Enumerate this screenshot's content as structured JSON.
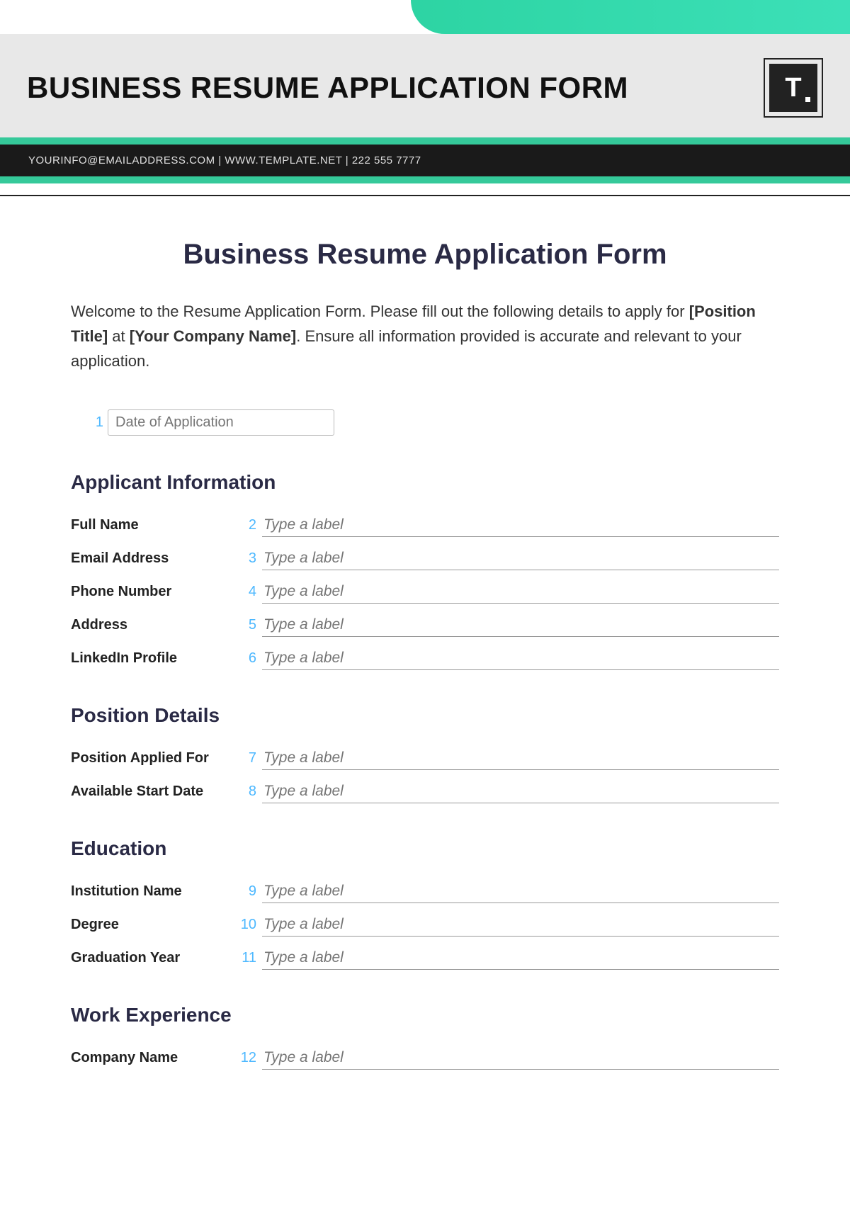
{
  "header": {
    "title": "BUSINESS RESUME APPLICATION FORM",
    "logo_text": "T",
    "contact_line": "YOURINFO@EMAILADDRESS.COM | WWW.TEMPLATE.NET | 222 555 7777"
  },
  "doc_title": "Business Resume Application Form",
  "intro": {
    "pre": "Welcome to the Resume Application Form. Please fill out the following details to apply for ",
    "bold1": "[Position Title]",
    "mid": " at ",
    "bold2": "[Your Company Name]",
    "post": ". Ensure all information provided is accurate and relevant to your application."
  },
  "date_field": {
    "num": "1",
    "placeholder": "Date of Application"
  },
  "sections": [
    {
      "title": "Applicant Information",
      "fields": [
        {
          "label": "Full Name",
          "num": "2",
          "placeholder": "Type a label"
        },
        {
          "label": "Email Address",
          "num": "3",
          "placeholder": "Type a label"
        },
        {
          "label": "Phone Number",
          "num": "4",
          "placeholder": "Type a label"
        },
        {
          "label": "Address",
          "num": "5",
          "placeholder": "Type a label"
        },
        {
          "label": "LinkedIn Profile",
          "num": "6",
          "placeholder": "Type a label"
        }
      ]
    },
    {
      "title": "Position Details",
      "fields": [
        {
          "label": "Position Applied For",
          "num": "7",
          "placeholder": "Type a label"
        },
        {
          "label": "Available Start Date",
          "num": "8",
          "placeholder": "Type a label"
        }
      ]
    },
    {
      "title": "Education",
      "fields": [
        {
          "label": "Institution Name",
          "num": "9",
          "placeholder": "Type a label"
        },
        {
          "label": "Degree",
          "num": "10",
          "placeholder": "Type a label"
        },
        {
          "label": "Graduation Year",
          "num": "11",
          "placeholder": "Type a label"
        }
      ]
    },
    {
      "title": "Work Experience",
      "fields": [
        {
          "label": "Company Name",
          "num": "12",
          "placeholder": "Type a label"
        }
      ]
    }
  ]
}
